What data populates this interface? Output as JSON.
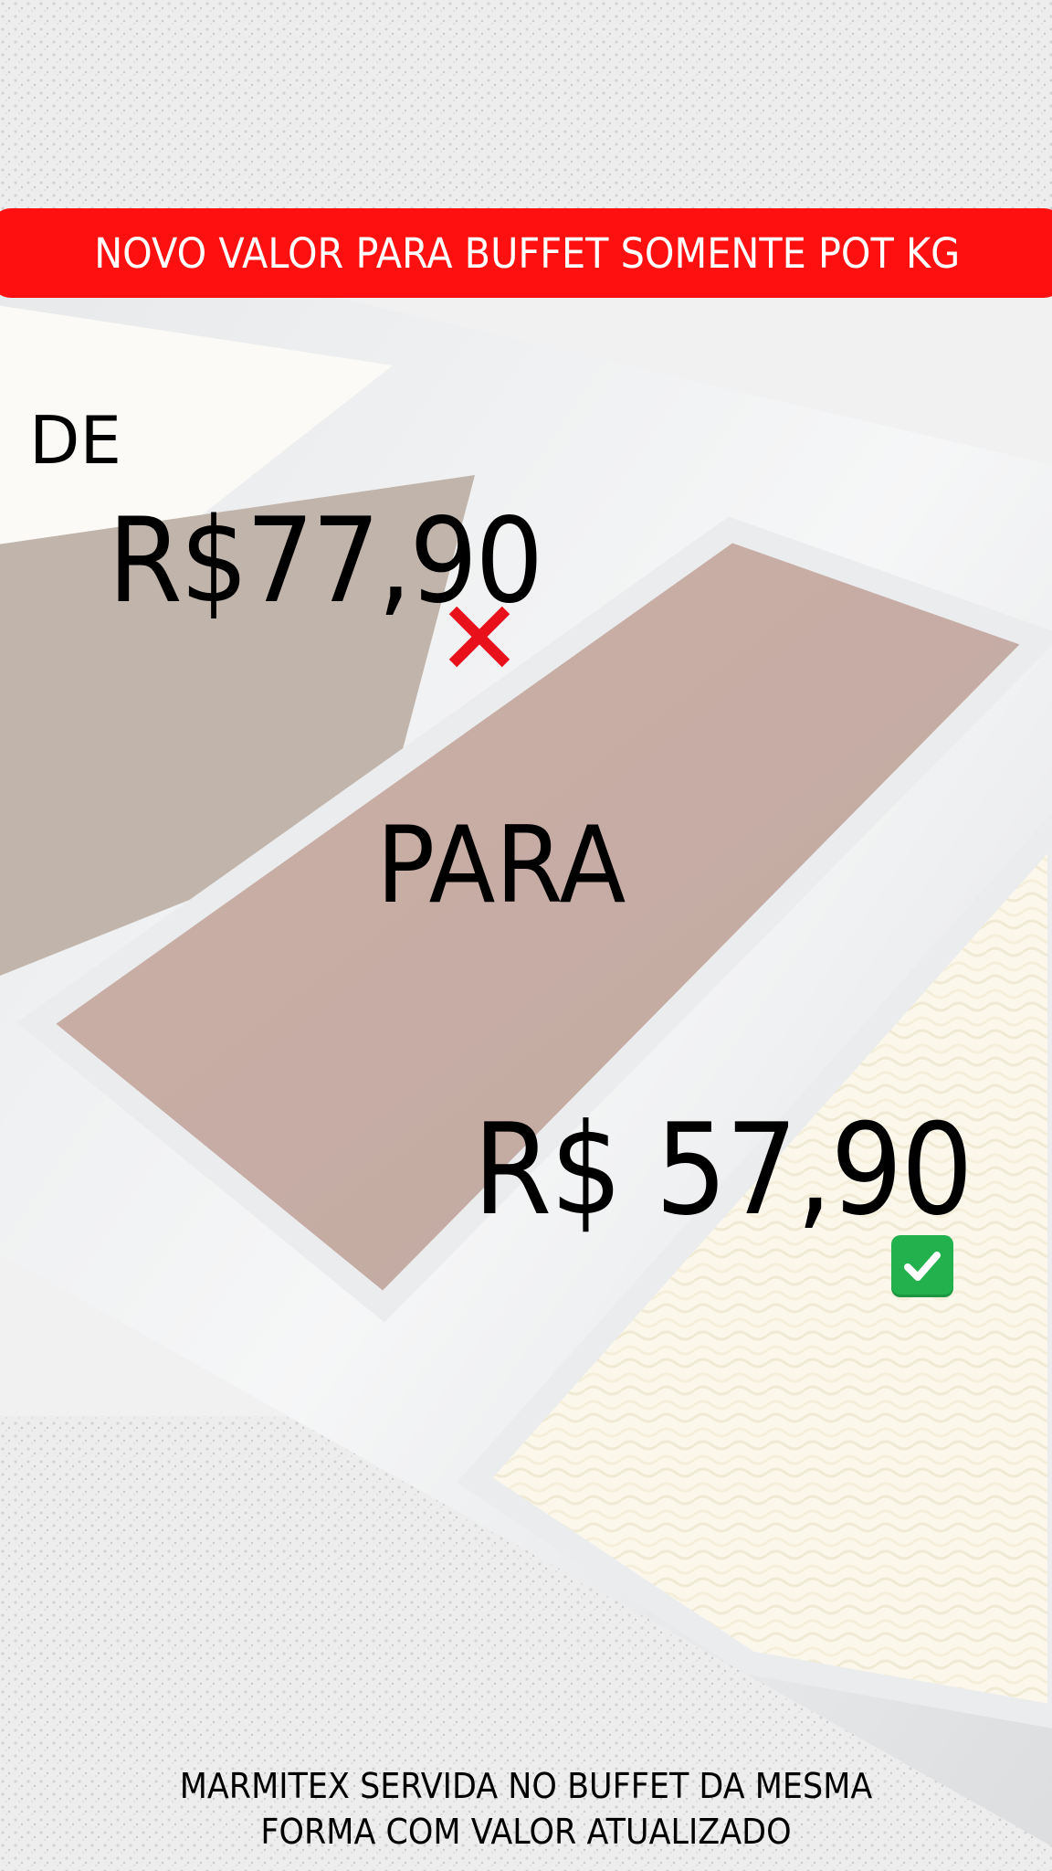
{
  "banner": {
    "text": "NOVO VALOR PARA BUFFET SOMENTE POT KG",
    "color": "#ff1010"
  },
  "pricing": {
    "from_label": "DE",
    "old_price": "R$77,90",
    "old_price_marker": "cross-mark-icon",
    "to_label": "PARA",
    "new_price": "R$ 57,90",
    "new_price_marker": "check-mark-icon"
  },
  "footer": {
    "line1": "MARMITEX SERVIDA NO BUFFET DA MESMA",
    "line2": "FORMA COM VALOR ATUALIZADO"
  },
  "colors": {
    "text": "#000000",
    "cross": "#e8101a",
    "check": "#22b14c"
  }
}
